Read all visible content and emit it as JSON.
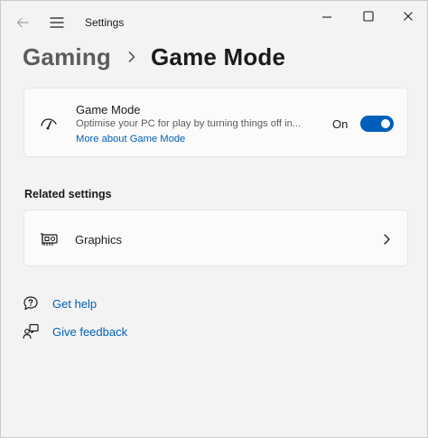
{
  "window": {
    "title": "Settings"
  },
  "breadcrumb": {
    "parent": "Gaming",
    "current": "Game Mode"
  },
  "game_mode_card": {
    "title": "Game Mode",
    "description": "Optimise your PC for play by turning things off in...",
    "link": "More about Game Mode",
    "toggle_state_label": "On",
    "toggle_on": true,
    "icon": "game-mode-gauge-icon"
  },
  "related_settings": {
    "heading": "Related settings",
    "items": [
      {
        "label": "Graphics",
        "icon": "graphics-card-icon"
      }
    ]
  },
  "help_links": [
    {
      "label": "Get help",
      "icon": "get-help-icon"
    },
    {
      "label": "Give feedback",
      "icon": "feedback-icon"
    }
  ],
  "colors": {
    "accent": "#005fb8",
    "background": "#f3f3f3",
    "card": "#fbfbfb"
  }
}
